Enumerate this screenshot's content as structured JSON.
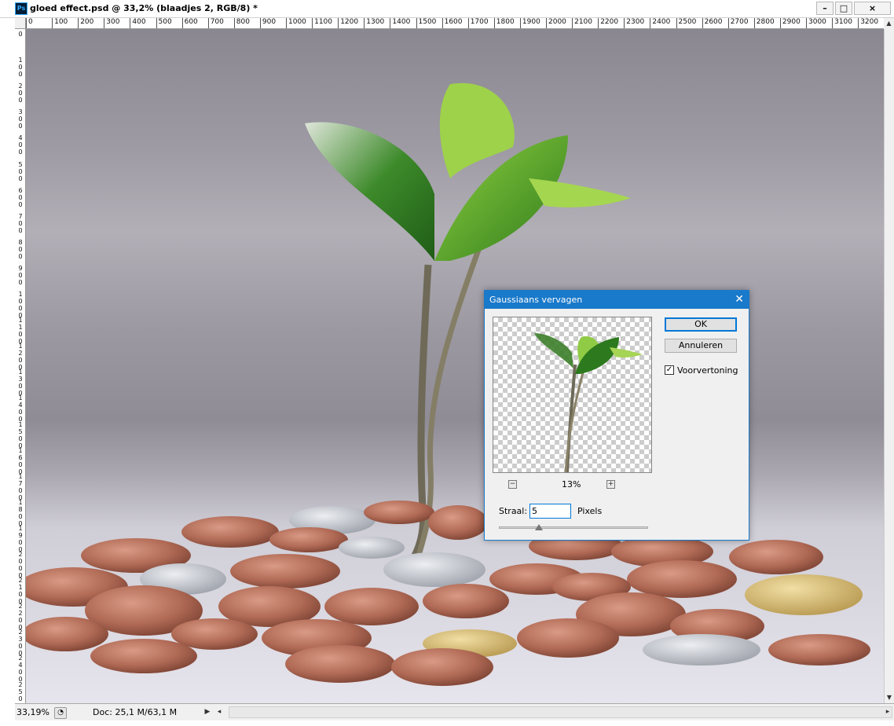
{
  "window": {
    "logo": "Ps",
    "title": "gloed effect.psd @ 33,2% (blaadjes 2, RGB/8) *",
    "minimize": "–",
    "maximize": "□",
    "close": "×"
  },
  "ruler": {
    "h_ticks": [
      "0",
      "100",
      "200",
      "300",
      "400",
      "500",
      "600",
      "700",
      "800",
      "900",
      "1000",
      "1100",
      "1200",
      "1300",
      "1400",
      "1500",
      "1600",
      "1700",
      "1800",
      "1900",
      "2000",
      "2100",
      "2200",
      "2300",
      "2400",
      "2500",
      "2600",
      "2700",
      "2800",
      "2900",
      "3000",
      "3100",
      "3200",
      "33"
    ],
    "v_ticks": [
      "0",
      "100",
      "200",
      "300",
      "400",
      "500",
      "600",
      "700",
      "800",
      "900",
      "1000",
      "1100",
      "1200",
      "1300",
      "1400",
      "1500",
      "1600",
      "1700",
      "1800",
      "1900",
      "2000",
      "2100",
      "2200",
      "2300",
      "2400",
      "2500"
    ]
  },
  "status": {
    "zoom": "33,19%",
    "doc_info": "Doc: 25,1 M/63,1 M"
  },
  "dialog": {
    "title": "Gaussiaans vervagen",
    "close": "✕",
    "ok": "OK",
    "cancel": "Annuleren",
    "preview_label": "Voorvertoning",
    "preview_checked": true,
    "zoom_minus": "−",
    "zoom_plus": "+",
    "zoom_percent": "13%",
    "radius_label": "Straal:",
    "radius_value": "5",
    "radius_unit": "Pixels",
    "slider_fraction": 0.27
  },
  "colors": {
    "dialog_title_bg": "#1979ca",
    "button_focus": "#0078d7"
  }
}
